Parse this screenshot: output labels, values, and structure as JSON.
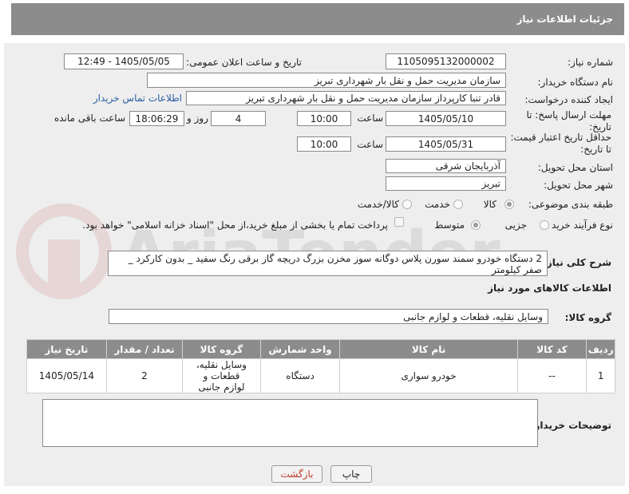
{
  "header": {
    "title": "جزئیات اطلاعات نیاز"
  },
  "need_number": {
    "label": "شماره نیاز:",
    "value": "1105095132000002"
  },
  "announce_datetime": {
    "label": "تاریخ و ساعت اعلان عمومی:",
    "value": "1405/05/05 - 12:49"
  },
  "buyer_org": {
    "label": "نام دستگاه خریدار:",
    "value": "سازمان مدیریت حمل و نقل بار شهرداری تبریز"
  },
  "requester": {
    "label": "ایجاد کننده درخواست:",
    "value": "قادر تنبا کارپرداز سازمان مدیریت حمل و نقل بار شهرداری تبریز",
    "contact_link": "اطلاعات تماس خریدار"
  },
  "reply_deadline": {
    "label": "مهلت ارسال پاسخ: تا تاریخ:",
    "date": "1405/05/10",
    "time_label": "ساعت",
    "time": "10:00",
    "days": "4",
    "days_label": "روز و",
    "remaining": "18:06:29",
    "remaining_label": "ساعت باقی مانده"
  },
  "price_validity": {
    "label": "حداقل تاریخ اعتبار قیمت: تا تاریخ:",
    "date": "1405/05/31",
    "time_label": "ساعت",
    "time": "10:00"
  },
  "delivery_province": {
    "label": "استان محل تحویل:",
    "value": "آذربایجان شرقی"
  },
  "delivery_city": {
    "label": "شهر محل تحویل:",
    "value": "تبریز"
  },
  "category": {
    "label": "طبقه بندی موضوعی:",
    "options": [
      "کالا",
      "خدمت",
      "کالا/خدمت"
    ],
    "selected": "کالا"
  },
  "purchase_process": {
    "label": "نوع فرآیند خرید :",
    "options": [
      "جزیی",
      "متوسط"
    ],
    "selected": "متوسط",
    "payment_note": "پرداخت تمام یا بخشی از مبلغ خرید،از محل \"اسناد خزانه اسلامی\" خواهد بود."
  },
  "general_description": {
    "label": "شرح کلی نیاز:",
    "value": "2 دستگاه خودرو سمند سورن پلاس دوگانه سوز مخزن بزرگ دریچه گاز برقی  رنگ سفید _ بدون کارکرد _ صفر کیلومتر"
  },
  "goods_info": {
    "title": "اطلاعات کالاهای مورد نیاز"
  },
  "goods_group": {
    "label": "گروه کالا:",
    "value": "وسایل نقلیه، قطعات و لوازم جانبی"
  },
  "goods_table": {
    "headers": [
      "ردیف",
      "کد کالا",
      "نام کالا",
      "واحد شمارش",
      "گروه کالا",
      "تعداد / مقدار",
      "تاریخ نیاز"
    ],
    "rows": [
      [
        "1",
        "--",
        "خودرو سواری",
        "دستگاه",
        "وسایل نقلیه، قطعات و لوازم جانبی",
        "2",
        "1405/05/14"
      ]
    ]
  },
  "buyer_notes": {
    "label": "توضیحات خریدار:",
    "value": ""
  },
  "buttons": {
    "print": "چاپ",
    "back": "بازگشت"
  },
  "watermark": {
    "text": "AriaTender.neT"
  },
  "colors": {
    "header_bg": "#8c8c8c",
    "panel_bg": "#eeeeee",
    "link": "#2a5ea6",
    "back_button_text": "#c0392b"
  }
}
